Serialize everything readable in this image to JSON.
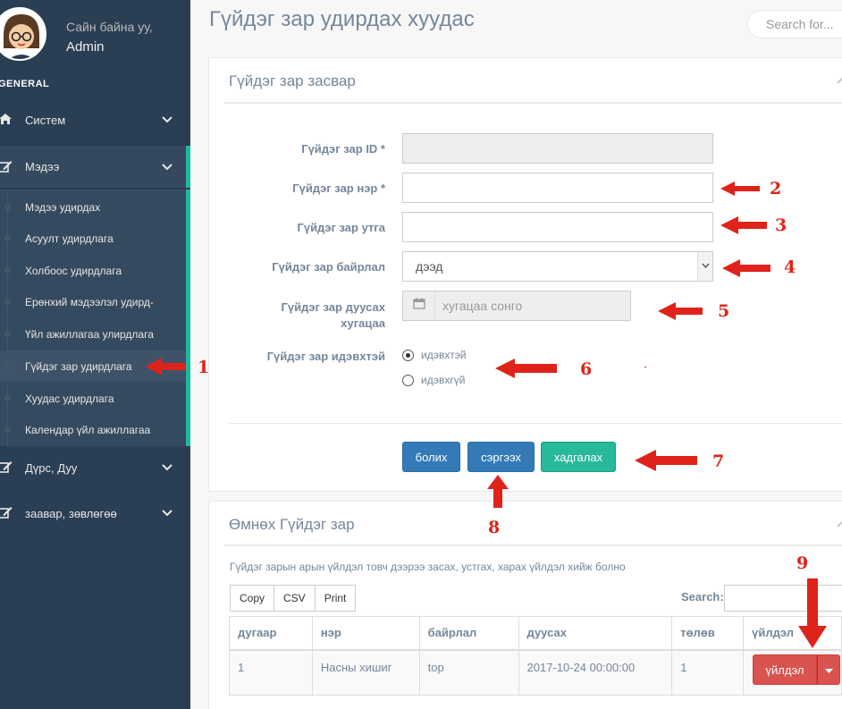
{
  "sidebar": {
    "greeting": "Сайн байна уу,",
    "username": "Admin",
    "section": "GENERAL",
    "menu": [
      {
        "label": "Систем",
        "icon": "home-icon"
      },
      {
        "label": "Мэдээ",
        "icon": "edit-icon"
      },
      {
        "label": "Дүрс, Дуу",
        "icon": "edit-icon"
      },
      {
        "label": "заавар, зөвлөгөө",
        "icon": "edit-icon"
      }
    ],
    "submenu": [
      "Мэдээ удирдах",
      "Асуулт удирдлага",
      "Холбоос удирдлага",
      "Ерөнхий мэдээлэл удирд-",
      "Үйл ажиллагаа улирдлага",
      "Гүйдэг зар удирдлага",
      "Хуудас удирдлага",
      "Календар үйл ажиллагаа"
    ]
  },
  "header": {
    "title": "Гүйдэг зар удирдах хуудас",
    "search_placeholder": "Search for..."
  },
  "form_panel": {
    "title": "Гүйдэг зар засвар",
    "fields": {
      "id_label": "Гүйдэг зар ID *",
      "name_label": "Гүйдэг зар нэр *",
      "value_label": "Гүйдэг зар утга",
      "position_label": "Гүйдэг зар байрлал",
      "position_value": "дээд",
      "expiry_label_1": "Гүйдэг зар дуусах",
      "expiry_label_2": "хугацаа",
      "expiry_placeholder": "хугацаа сонго",
      "active_label": "Гүйдэг зар идэвхтэй",
      "active_yes": "идэвхтэй",
      "active_no": "идэвхгүй"
    },
    "buttons": {
      "cancel": "болих",
      "refresh": "сэргээх",
      "save": "хадгалах"
    }
  },
  "list_panel": {
    "title": "Өмнөх Гүйдэг зар",
    "note": "Гүйдэг зарын арын үйлдэл товч дээрээ засах, устгах, харах үйлдэл хийж болно",
    "export_buttons": [
      "Copy",
      "CSV",
      "Print"
    ],
    "search_label": "Search:",
    "columns": [
      "дугаар",
      "нэр",
      "байрлал",
      "дуусах",
      "төлөв",
      "үйлдэл"
    ],
    "rows": [
      {
        "number": "1",
        "name": "Насны хишиг",
        "position": "top",
        "expires": "2017-10-24 00:00:00",
        "status": "1",
        "action": "үйлдэл"
      }
    ]
  },
  "annotations": [
    "1",
    "2",
    "3",
    "4",
    "5",
    "6",
    "7",
    "8",
    "9"
  ],
  "colors": {
    "sidebar": "#2A3F54",
    "accent": "#1ABB9C",
    "primary": "#337AB7",
    "success": "#26B99A",
    "danger": "#D9534F",
    "annotation": "#E0231A"
  }
}
